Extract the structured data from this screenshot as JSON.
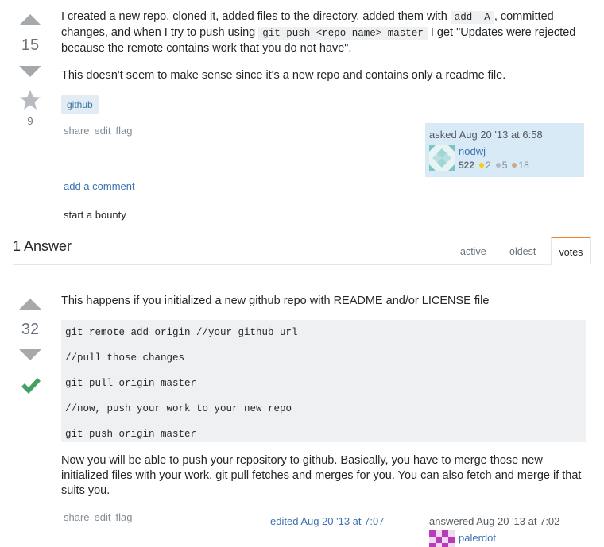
{
  "question": {
    "vote_count": "15",
    "favorite_count": "9",
    "body": {
      "p1_a": "I created a new repo, cloned it, added files to the directory, added them with ",
      "p1_code1": "add -A",
      "p1_b": ", committed",
      "p1_c": "changes, and when I try to push using ",
      "p1_code2": "git push <repo name> master",
      "p1_d": " I get \"Updates were rejected",
      "p1_e": "because the remote contains work that you do not have\".",
      "p2": "This doesn't seem to make sense since it's a new repo and contains only a readme file."
    },
    "tags": [
      "github"
    ],
    "menu": {
      "share": "share",
      "edit": "edit",
      "flag": "flag"
    },
    "owner": {
      "asked": "asked Aug 20 '13 at 6:58",
      "name": "nodwj",
      "reputation": "522",
      "gold": "2",
      "silver": "5",
      "bronze": "18"
    },
    "add_comment": "add a comment",
    "start_bounty": "start a bounty"
  },
  "answers_header": {
    "count_label": "1 Answer",
    "tabs": [
      "active",
      "oldest",
      "votes"
    ],
    "active_tab": "votes"
  },
  "answer": {
    "vote_count": "32",
    "intro": "This happens if you initialized a new github repo with README and/or LICENSE file",
    "code_lines": [
      "git remote add origin //your github url",
      "//pull those changes",
      "git pull origin master",
      "//now, push your work to your new repo",
      "git push origin master"
    ],
    "outro_1": "Now you will be able to push your repository to github. Basically, you have to merge those new",
    "outro_2": "initialized files with your work. git pull fetches and merges for you. You can also fetch and merge if that",
    "outro_3": "suits you.",
    "menu": {
      "share": "share",
      "edit": "edit",
      "flag": "flag"
    },
    "edited": "edited Aug 20 '13 at 7:07",
    "answered": "answered Aug 20 '13 at 7:02",
    "author": "palerdot"
  },
  "colors": {
    "accept_green": "#45a163",
    "tab_accent": "#f48024",
    "link_blue": "#3a73b0",
    "gold": "#ffcc01",
    "silver": "#b4b8bc",
    "bronze": "#d1a684"
  }
}
